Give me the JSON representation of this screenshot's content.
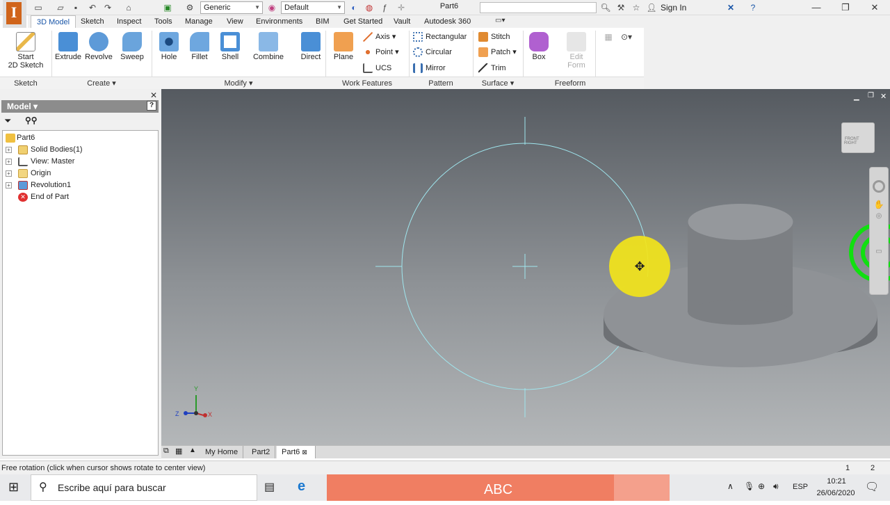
{
  "app": {
    "title": "Part6",
    "search_placeholder": "",
    "sign_in": "Sign In"
  },
  "toolbar": {
    "material": "Generic",
    "appearance": "Default"
  },
  "menu_tabs": [
    "3D Model",
    "Sketch",
    "Inspect",
    "Tools",
    "Manage",
    "View",
    "Environments",
    "BIM",
    "Get Started",
    "Vault",
    "Autodesk 360"
  ],
  "ribbon": {
    "sketch": {
      "label1": "Start",
      "label2": "2D Sketch",
      "group": "Sketch"
    },
    "create": {
      "extrude": "Extrude",
      "revolve": "Revolve",
      "sweep": "Sweep",
      "group": "Create"
    },
    "modify": {
      "hole": "Hole",
      "fillet": "Fillet",
      "shell": "Shell",
      "combine": "Combine",
      "direct": "Direct",
      "group": "Modify"
    },
    "work": {
      "plane": "Plane",
      "axis": "Axis",
      "point": "Point",
      "ucs": "UCS",
      "group": "Work Features"
    },
    "pattern": {
      "rect": "Rectangular",
      "circ": "Circular",
      "mirror": "Mirror",
      "group": "Pattern"
    },
    "surface": {
      "stitch": "Stitch",
      "patch": "Patch",
      "trim": "Trim",
      "group": "Surface"
    },
    "freeform": {
      "box": "Box",
      "edit1": "Edit",
      "edit2": "Form",
      "group": "Freeform"
    }
  },
  "browser": {
    "title": "Model",
    "nodes": [
      "Part6",
      "Solid Bodies(1)",
      "View: Master",
      "Origin",
      "Revolution1",
      "End of Part"
    ]
  },
  "viewcube": {
    "front": "FRONT",
    "right": "RIGHT"
  },
  "axes": {
    "x": "X",
    "y": "Y",
    "z": "Z"
  },
  "doc_tabs": [
    "My Home",
    "Part2",
    "Part6"
  ],
  "status": {
    "text": "Free rotation (click when cursor shows rotate to center view)",
    "n1": "1",
    "n2": "2"
  },
  "taskbar": {
    "search": "Escribe aquí para buscar",
    "banner": "ABC",
    "lang": "ESP",
    "time": "10:21",
    "date": "26/06/2020"
  },
  "colors": {
    "accent": "#1a56a8",
    "sketch_circle": "#9fe6ee",
    "highlight": "#f2e41a",
    "ring": "#10e010",
    "logo": "#d0641a"
  }
}
